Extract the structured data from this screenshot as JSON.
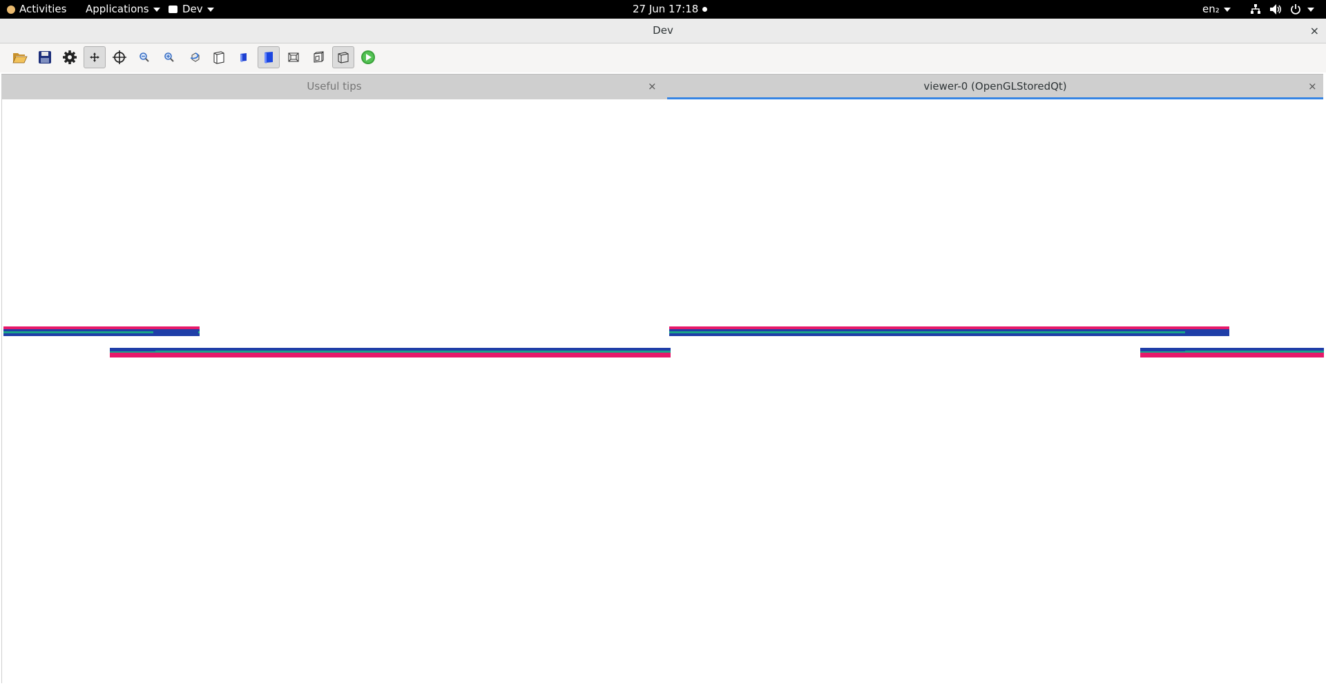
{
  "topbar": {
    "activities": "Activities",
    "applications": "Applications",
    "app_name": "Dev",
    "clock": "27 Jun  17:18",
    "keyboard_layout": "en₂"
  },
  "window": {
    "title": "Dev",
    "close_glyph": "×"
  },
  "toolbar": {
    "tools": [
      {
        "name": "open-icon",
        "active": false
      },
      {
        "name": "save-icon",
        "active": false
      },
      {
        "name": "settings-icon",
        "active": false
      },
      {
        "name": "move-icon",
        "active": true
      },
      {
        "name": "pick-target-icon",
        "active": false
      },
      {
        "name": "zoom-out-icon",
        "active": false
      },
      {
        "name": "zoom-in-icon",
        "active": false
      },
      {
        "name": "rotate-icon",
        "active": false
      },
      {
        "name": "wireframe-view-icon",
        "active": false
      },
      {
        "name": "surface-view-icon",
        "active": false
      },
      {
        "name": "solid-view-icon",
        "active": true
      },
      {
        "name": "perspective-icon",
        "active": false
      },
      {
        "name": "ortho-icon",
        "active": false
      },
      {
        "name": "hidden-line-icon",
        "active": true
      },
      {
        "name": "run-icon",
        "active": false
      }
    ]
  },
  "tabs": [
    {
      "label": "Useful tips",
      "selected": false,
      "close_glyph": "×"
    },
    {
      "label": "viewer-0 (OpenGLStoredQt)",
      "selected": true,
      "close_glyph": "×"
    }
  ],
  "colors": {
    "magenta": "#e6196a",
    "blue": "#1f3ea8",
    "teal": "#1aa58a",
    "accent": "#3584e4"
  }
}
